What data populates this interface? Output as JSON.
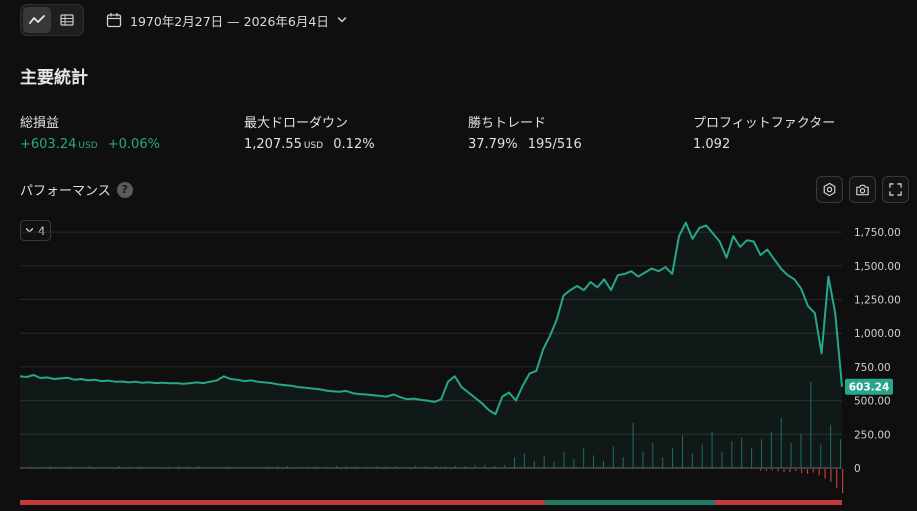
{
  "date_range": {
    "label": "1970年2月27日 — 2026年6月4日"
  },
  "section_title": "主要統計",
  "stats": [
    {
      "label": "総損益",
      "value": "+603.24",
      "unit": "USD",
      "extra": "+0.06%",
      "positive": true
    },
    {
      "label": "最大ドローダウン",
      "value": "1,207.55",
      "unit": "USD",
      "extra": "0.12%",
      "positive": false
    },
    {
      "label": "勝ちトレード",
      "value": "37.79%",
      "unit": "",
      "extra": "195/516",
      "positive": false
    },
    {
      "label": "プロフィットファクター",
      "value": "1.092",
      "unit": "",
      "extra": "",
      "positive": false
    }
  ],
  "performance": {
    "title": "パフォーマンス",
    "help": "?",
    "legend_count": "4"
  },
  "icons": {
    "line_view": "line-chart-icon",
    "table_view": "table-icon",
    "calendar": "calendar-icon",
    "settings": "settings-icon",
    "camera": "camera-icon",
    "fullscreen": "fullscreen-icon"
  },
  "colors": {
    "accent": "#26a68a",
    "negative": "#c23b3b",
    "background": "#0f0f0f"
  },
  "chart_data": {
    "type": "line",
    "y_ticks": [
      "1,750.00",
      "1,500.00",
      "1,250.00",
      "1,000.00",
      "750.00",
      "500.00",
      "250.00",
      "0"
    ],
    "ylim": [
      0,
      1850
    ],
    "grid": true,
    "last_value_label": "603.24",
    "series": [
      {
        "values": [
          680,
          675,
          690,
          668,
          672,
          660,
          665,
          670,
          655,
          660,
          650,
          655,
          645,
          648,
          640,
          642,
          635,
          640,
          632,
          636,
          630,
          632,
          628,
          630,
          625,
          628,
          635,
          630,
          640,
          650,
          680,
          660,
          655,
          645,
          650,
          640,
          635,
          630,
          620,
          615,
          610,
          600,
          595,
          590,
          585,
          575,
          570,
          565,
          572,
          555,
          548,
          545,
          540,
          535,
          530,
          545,
          525,
          510,
          515,
          505,
          500,
          490,
          510,
          640,
          680,
          600,
          560,
          520,
          480,
          430,
          400,
          530,
          560,
          500,
          610,
          700,
          720,
          880,
          980,
          1100,
          1280,
          1320,
          1350,
          1320,
          1380,
          1340,
          1400,
          1320,
          1430,
          1440,
          1460,
          1420,
          1450,
          1480,
          1460,
          1490,
          1440,
          1720,
          1820,
          1700,
          1780,
          1800,
          1740,
          1680,
          1560,
          1720,
          1640,
          1690,
          1680,
          1580,
          1620,
          1550,
          1480,
          1430,
          1400,
          1330,
          1200,
          1150,
          850,
          1420,
          1150,
          603
        ]
      }
    ],
    "volume": [
      {
        "sign": "positive",
        "values": [
          8,
          6,
          10,
          7,
          9,
          8,
          12,
          6,
          7,
          10,
          8,
          9,
          6,
          7,
          8,
          10,
          9,
          11,
          7,
          8,
          9,
          6,
          8,
          7,
          9,
          10,
          11,
          7,
          8,
          9,
          8,
          12,
          10,
          9,
          8,
          11,
          9,
          10,
          8,
          12,
          10,
          11,
          9,
          13,
          10,
          14,
          16,
          12,
          15,
          60,
          80,
          40,
          70,
          35,
          90,
          50,
          110,
          70,
          40,
          120,
          60,
          250,
          90,
          140,
          60,
          110,
          180,
          80,
          130,
          200,
          90,
          150,
          170,
          110,
          160,
          200,
          280,
          140,
          190,
          480,
          130,
          240,
          160
        ]
      },
      {
        "sign": "negative",
        "values": [
          10,
          12,
          8,
          15,
          18,
          20,
          14,
          25,
          30,
          22,
          40,
          60,
          80,
          120,
          150
        ]
      }
    ],
    "bottom_strip": {
      "colors": [
        "#c23b3b",
        "#1f7a66"
      ]
    }
  }
}
